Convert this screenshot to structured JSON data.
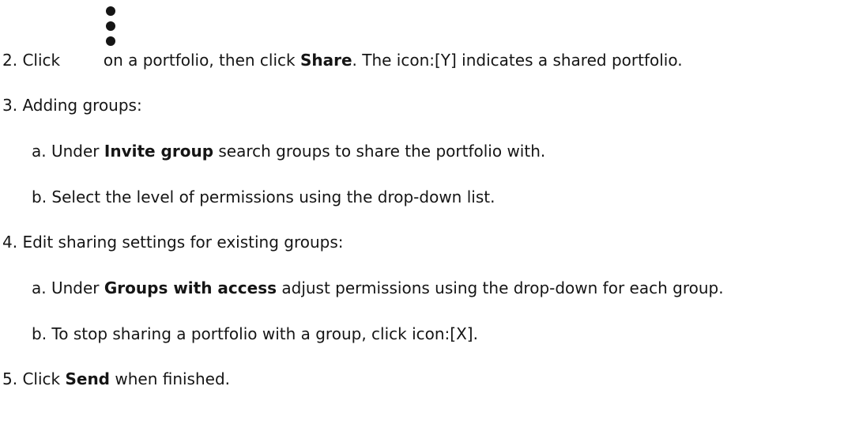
{
  "steps": [
    {
      "num": "2.",
      "pre": "Click",
      "after_icon": "on a portfolio, then click",
      "bold": "Share",
      "post": ". The icon:[Y] indicates a shared portfolio.",
      "icon": "kebab-vertical-icon"
    },
    {
      "num": "3.",
      "text": "Adding groups:",
      "subs": [
        {
          "letter": "a.",
          "pre": "Under",
          "bold": "Invite group",
          "post": "search groups to share the portfolio with."
        },
        {
          "letter": "b.",
          "text": "Select the level of permissions using the drop-down list."
        }
      ]
    },
    {
      "num": "4.",
      "text": "Edit sharing settings for existing groups:",
      "subs": [
        {
          "letter": "a.",
          "pre": "Under",
          "bold": "Groups with access",
          "post": "adjust permissions using the drop-down for each group."
        },
        {
          "letter": "b.",
          "text": "To stop sharing a portfolio with a group, click icon:[X]."
        }
      ]
    },
    {
      "num": "5.",
      "pre": "Click",
      "bold": "Send",
      "post": "when finished."
    }
  ]
}
